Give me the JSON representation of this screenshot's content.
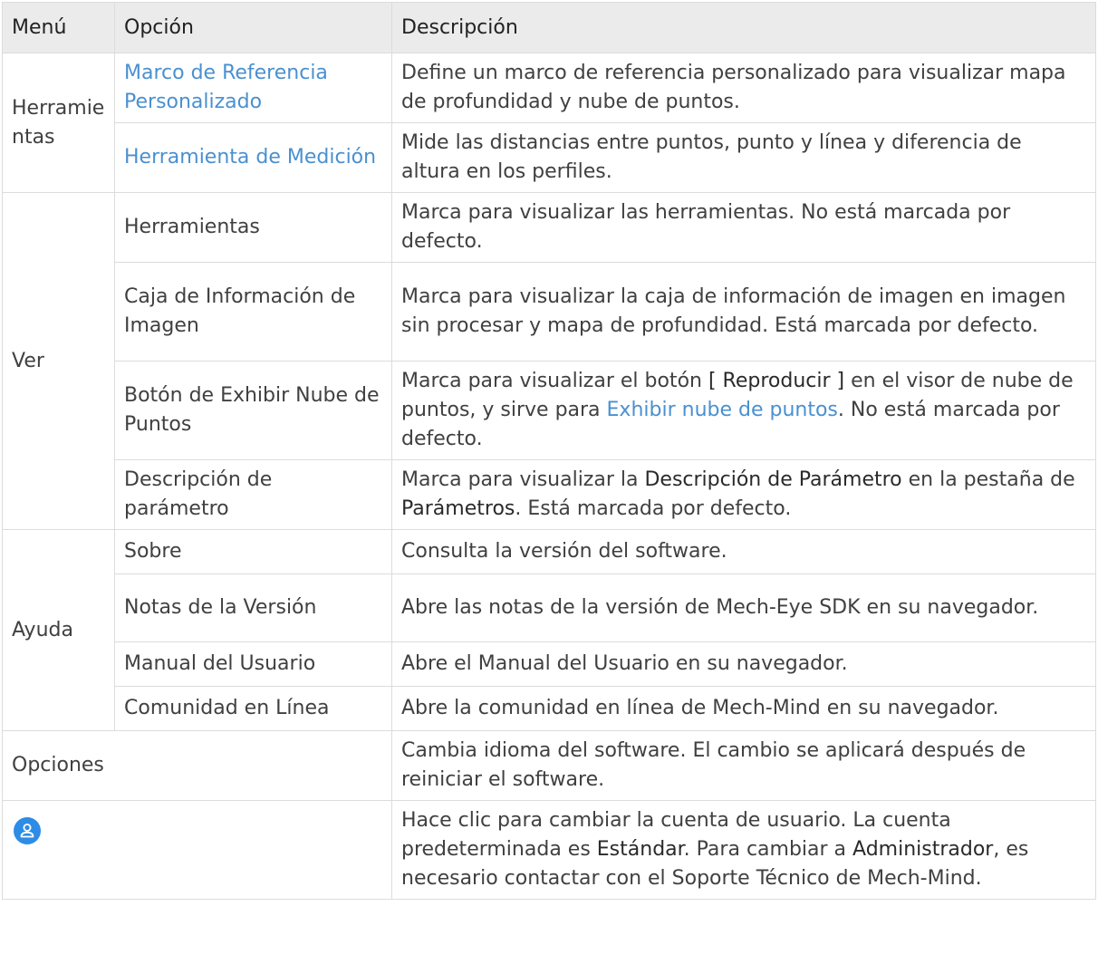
{
  "header": {
    "menu": "Menú",
    "option": "Opción",
    "description": "Descripción"
  },
  "groups": {
    "herramientas": "Herramie\nntas",
    "ver": "Ver",
    "ayuda": "Ayuda",
    "opciones": "Opciones"
  },
  "rows": {
    "marco": {
      "option": "Marco de Referencia Personalizado",
      "description": "Define un marco de referencia personalizado para visualizar mapa de profundidad y nube de puntos."
    },
    "medicion": {
      "option": "Herramienta de Medición",
      "description": "Mide las distancias entre puntos, punto y línea y diferencia de altura en los perfiles."
    },
    "herr": {
      "option": "Herramientas",
      "description": "Marca para visualizar las herramientas. No está marcada por defecto."
    },
    "caja": {
      "option": "Caja de Información de Imagen",
      "description": "Marca para visualizar la caja de información de imagen en imagen sin procesar y mapa de profundidad. Está marcada por defecto."
    },
    "boton": {
      "option": "Botón de Exhibir Nube de Puntos",
      "desc_1": "Marca para visualizar el botón ",
      "desc_bold": "[ Reproducir ]",
      "desc_2": " en el visor de nube de puntos, y sirve para ",
      "desc_link": "Exhibir nube de puntos",
      "desc_3": ". No está marcada por defecto."
    },
    "param": {
      "option": "Descripción de parámetro",
      "desc_1": "Marca para visualizar la ",
      "desc_bold1": "Descripción de Parámetro",
      "desc_2": " en la pestaña de ",
      "desc_bold2": "Parámetros",
      "desc_3": ". Está marcada por defecto."
    },
    "sobre": {
      "option": "Sobre",
      "description": "Consulta la versión del software."
    },
    "notas": {
      "option": "Notas de la Versión",
      "description": "Abre las notas de la versión de Mech-Eye SDK en su navegador."
    },
    "manual": {
      "option": "Manual del Usuario",
      "description": "Abre el Manual del Usuario en su navegador."
    },
    "comunidad": {
      "option": "Comunidad en Línea",
      "description": "Abre la comunidad en línea de Mech-Mind en su navegador."
    },
    "opciones": {
      "description": "Cambia idioma del software. El cambio se aplicará después de reiniciar el software."
    },
    "account": {
      "icon": "user-account-icon",
      "desc_1": "Hace clic para cambiar la cuenta de usuario. La cuenta predeterminada es ",
      "desc_bold1": "Estándar",
      "desc_2": ". Para cambiar a ",
      "desc_bold2": "Administrador",
      "desc_3": ", es necesario contactar con el Soporte Técnico de Mech-Mind."
    }
  },
  "colors": {
    "header_bg": "#ebebeb",
    "border": "#dcdcdc",
    "text": "#404040",
    "link": "#4a90d0",
    "icon_bg": "#2d8ce6"
  }
}
